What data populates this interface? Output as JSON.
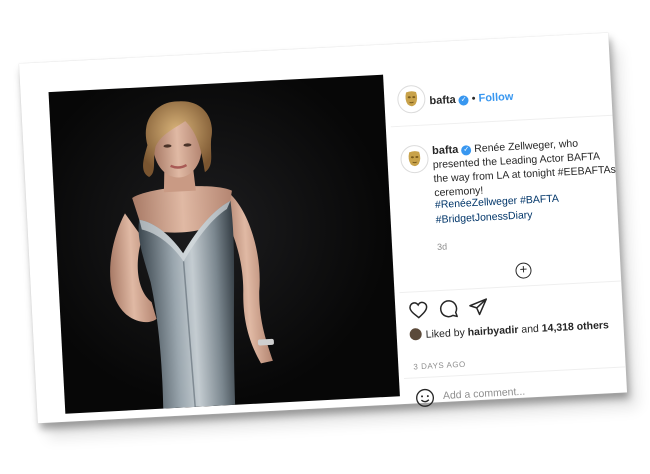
{
  "post": {
    "username": "bafta",
    "follow_label": "Follow",
    "separator": "•",
    "caption_username": "bafta",
    "caption_lines": [
      "Renée Zellweger, who",
      "presented the Leading Actor BAFTA",
      "the way from LA at tonight #EEBAFTAs",
      "ceremony!"
    ],
    "hashtag_lines": [
      "#RenéeZellweger #BAFTA",
      "#BridgetJonessDiary"
    ],
    "age": "3d",
    "liked_by_prefix": "Liked by",
    "liked_by_user": "hairbyadir",
    "liked_by_and": "and",
    "likes_count": "14,318 others",
    "timestamp": "3 DAYS AGO",
    "comment_placeholder": "Add a comment..."
  },
  "icons": {
    "avatar": "bafta-mask-logo",
    "verified": "verified-badge-icon",
    "load_more": "plus-circle-icon",
    "like": "heart-icon",
    "comment": "comment-bubble-icon",
    "share": "paper-plane-icon",
    "emoji": "emoji-smile-icon"
  },
  "colors": {
    "link_blue": "#3897f0",
    "hashtag": "#003569",
    "muted": "#8e8e8e",
    "text": "#262626"
  }
}
